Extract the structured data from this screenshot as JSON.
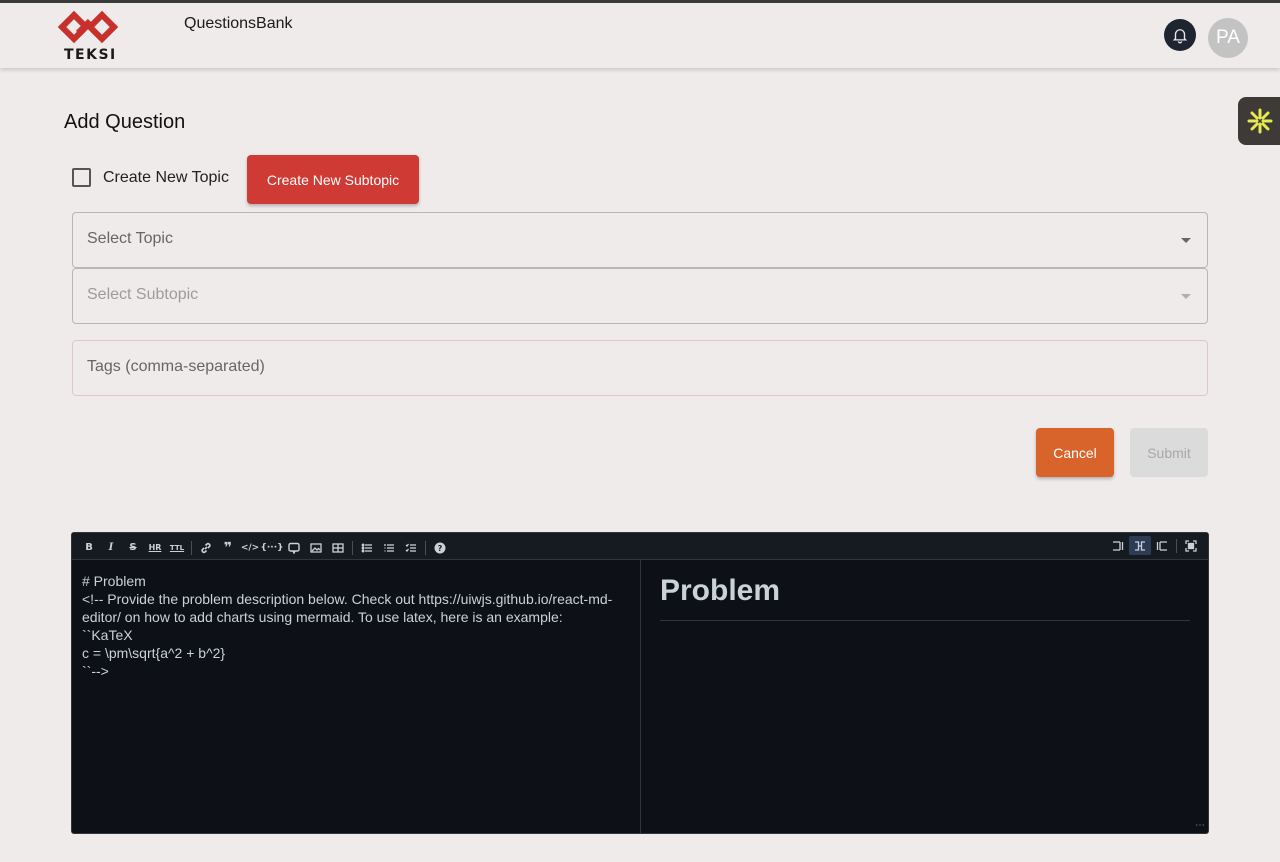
{
  "header": {
    "logo_text": "TEKSI",
    "app_title": "QuestionsBank",
    "avatar_initials": "PA"
  },
  "page": {
    "title": "Add Question"
  },
  "form": {
    "create_topic_label": "Create New Topic",
    "create_topic_checked": false,
    "create_subtopic_button": "Create New Subtopic",
    "topic_label": "Select Topic",
    "subtopic_label": "Select Subtopic",
    "tags_label": "Tags (comma-separated)",
    "cancel_button": "Cancel",
    "submit_button": "Submit"
  },
  "editor": {
    "toolbar_left": [
      "bold-icon",
      "italic-icon",
      "strikethrough-icon",
      "hr-icon",
      "title-icon",
      "link-icon",
      "quote-icon",
      "code-icon",
      "code-block-icon",
      "comment-icon",
      "image-icon",
      "table-icon",
      "unordered-list-icon",
      "ordered-list-icon",
      "checked-list-icon",
      "help-icon"
    ],
    "toolbar_right": [
      "edit-mode-icon",
      "live-mode-icon",
      "preview-mode-icon",
      "fullscreen-icon"
    ],
    "source_lines": [
      "# Problem",
      "<!-- Provide the problem description below. Check out https://uiwjs.github.io/react-md-editor/ on how to add charts using mermaid. To use latex, here is an example:",
      "``KaTeX",
      "c = \\pm\\sqrt{a^2 + b^2}",
      "``-->"
    ],
    "preview_heading": "Problem"
  },
  "colors": {
    "create_subtopic_bg": "#cf3a35",
    "cancel_bg": "#d8642b",
    "editor_bg": "#0d1117",
    "logo_red": "#c8302c"
  }
}
